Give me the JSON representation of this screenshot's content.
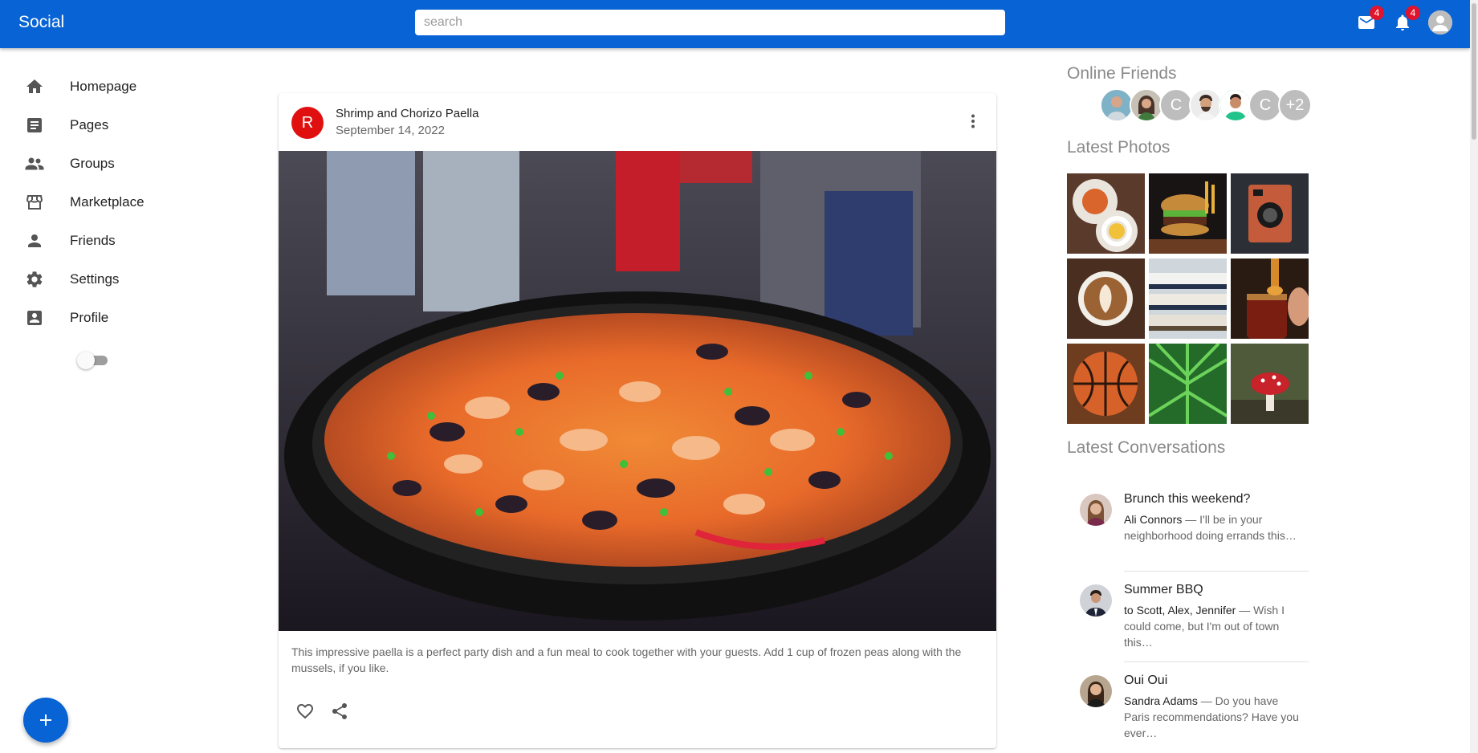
{
  "app": {
    "title": "Social",
    "accent": "#0863d4",
    "badge_color": "#e0142b"
  },
  "header": {
    "search_placeholder": "search",
    "mail_badge": "4",
    "notifications_badge": "4",
    "icons": [
      "mail-icon",
      "notifications-icon",
      "account-icon"
    ]
  },
  "sidebar": {
    "items": [
      {
        "label": "Homepage",
        "icon": "home-icon"
      },
      {
        "label": "Pages",
        "icon": "article-icon"
      },
      {
        "label": "Groups",
        "icon": "groups-icon"
      },
      {
        "label": "Marketplace",
        "icon": "storefront-icon"
      },
      {
        "label": "Friends",
        "icon": "person-icon"
      },
      {
        "label": "Settings",
        "icon": "gear-icon"
      },
      {
        "label": "Profile",
        "icon": "account-box-icon"
      }
    ],
    "dark_mode_enabled": false
  },
  "post": {
    "avatar_letter": "R",
    "avatar_color": "#e11010",
    "title": "Shrimp and Chorizo Paella",
    "date": "September 14, 2022",
    "text": "This impressive paella is a perfect party dish and a fun meal to cook together with your guests. Add 1 cup of frozen peas along with the mussels, if you like."
  },
  "right": {
    "online_title": "Online Friends",
    "online_letter_1": "C",
    "online_letter_2": "C",
    "online_more": "+2",
    "photos_title": "Latest Photos",
    "photos": [
      "breakfast-plates",
      "burger-and-fries",
      "vintage-camera",
      "latte-art",
      "stacked-hats",
      "honey-jar",
      "basketball",
      "green-fern",
      "red-mushroom"
    ],
    "conversations_title": "Latest Conversations",
    "conversations": [
      {
        "title": "Brunch this weekend?",
        "who": "Ali Connors",
        "snippet": " — I'll be in your neighborhood doing errands this…"
      },
      {
        "title": "Summer BBQ",
        "who": "to Scott, Alex, Jennifer",
        "snippet": " — Wish I could come, but I'm out of town this…"
      },
      {
        "title": "Oui Oui",
        "who": "Sandra Adams",
        "snippet": " — Do you have Paris recommendations? Have you ever…"
      }
    ]
  }
}
